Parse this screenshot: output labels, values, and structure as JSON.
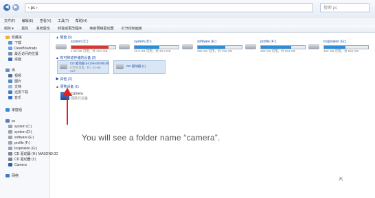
{
  "address": {
    "path": "‹ pc ›"
  },
  "search": {
    "placeholder": "搜索 pc"
  },
  "menubar": [
    "文件(F)",
    "编辑(E)",
    "查看(V)",
    "工具(T)",
    "帮助(H)"
  ],
  "toolbar": [
    "组织 ▾",
    "属性",
    "系统属性",
    "卸载或更改程序",
    "映射网络驱动器",
    "打开控制面板"
  ],
  "sidebar": {
    "favorites": [
      "收藏夹",
      "下载",
      "DeskBhudrads",
      "最近访问的位置",
      "桌面"
    ],
    "libraries": [
      "库",
      "视频",
      "图片",
      "文档",
      "迅雷下载",
      "音乐"
    ],
    "homegroup": "家庭组",
    "computer": "pc",
    "drives": [
      "system (C:)",
      "system (D:)",
      "software (E:)",
      "profile (F:)",
      "Inspiration (G:)",
      "CD 驱动器 (H:) MASON0.0D",
      "CD 驱动器 (I:)",
      "Camera"
    ],
    "network": "网络"
  },
  "sections": {
    "hard_disks": "▲ 硬盘 (5)",
    "removable": "▲ 有可移动存储的设备 (2)",
    "other": "▶ 其他 (2)",
    "portable": "▲ 便携设备 (1)"
  },
  "drives": [
    {
      "name": "system (C:)",
      "free": "4.68 GB 可用，共 19.5 GB",
      "fill": 0.85,
      "color": "#d9372f"
    },
    {
      "name": "system (D:)",
      "free": "16.8 GB 可用，共 39.2 GB",
      "fill": 0.57,
      "color": "#2a8fd9"
    },
    {
      "name": "software (E:)",
      "free": "286 GB 可用，共 765 GB",
      "fill": 0.63,
      "color": "#2a8fd9"
    },
    {
      "name": "profile (F:)",
      "free": "288 GB 可用，共 894 GB",
      "fill": 0.68,
      "color": "#2a8fd9"
    },
    {
      "name": "Inspiration (G:)",
      "free": "462 GB 可用，共 894 GB",
      "fill": 0.48,
      "color": "#2a8fd9"
    }
  ],
  "removable": [
    {
      "name": "CD 驱动器 (H:) MASON0.0D",
      "free": "0 字节 可用，共 1.33 MB",
      "sub": "UDF"
    },
    {
      "name": "CD 驱动器 (I:)",
      "free": "",
      "sub": ""
    }
  ],
  "portable": {
    "name": "Camera",
    "sub": "便携式设备"
  },
  "caption": "You will see a folder name “camera”."
}
